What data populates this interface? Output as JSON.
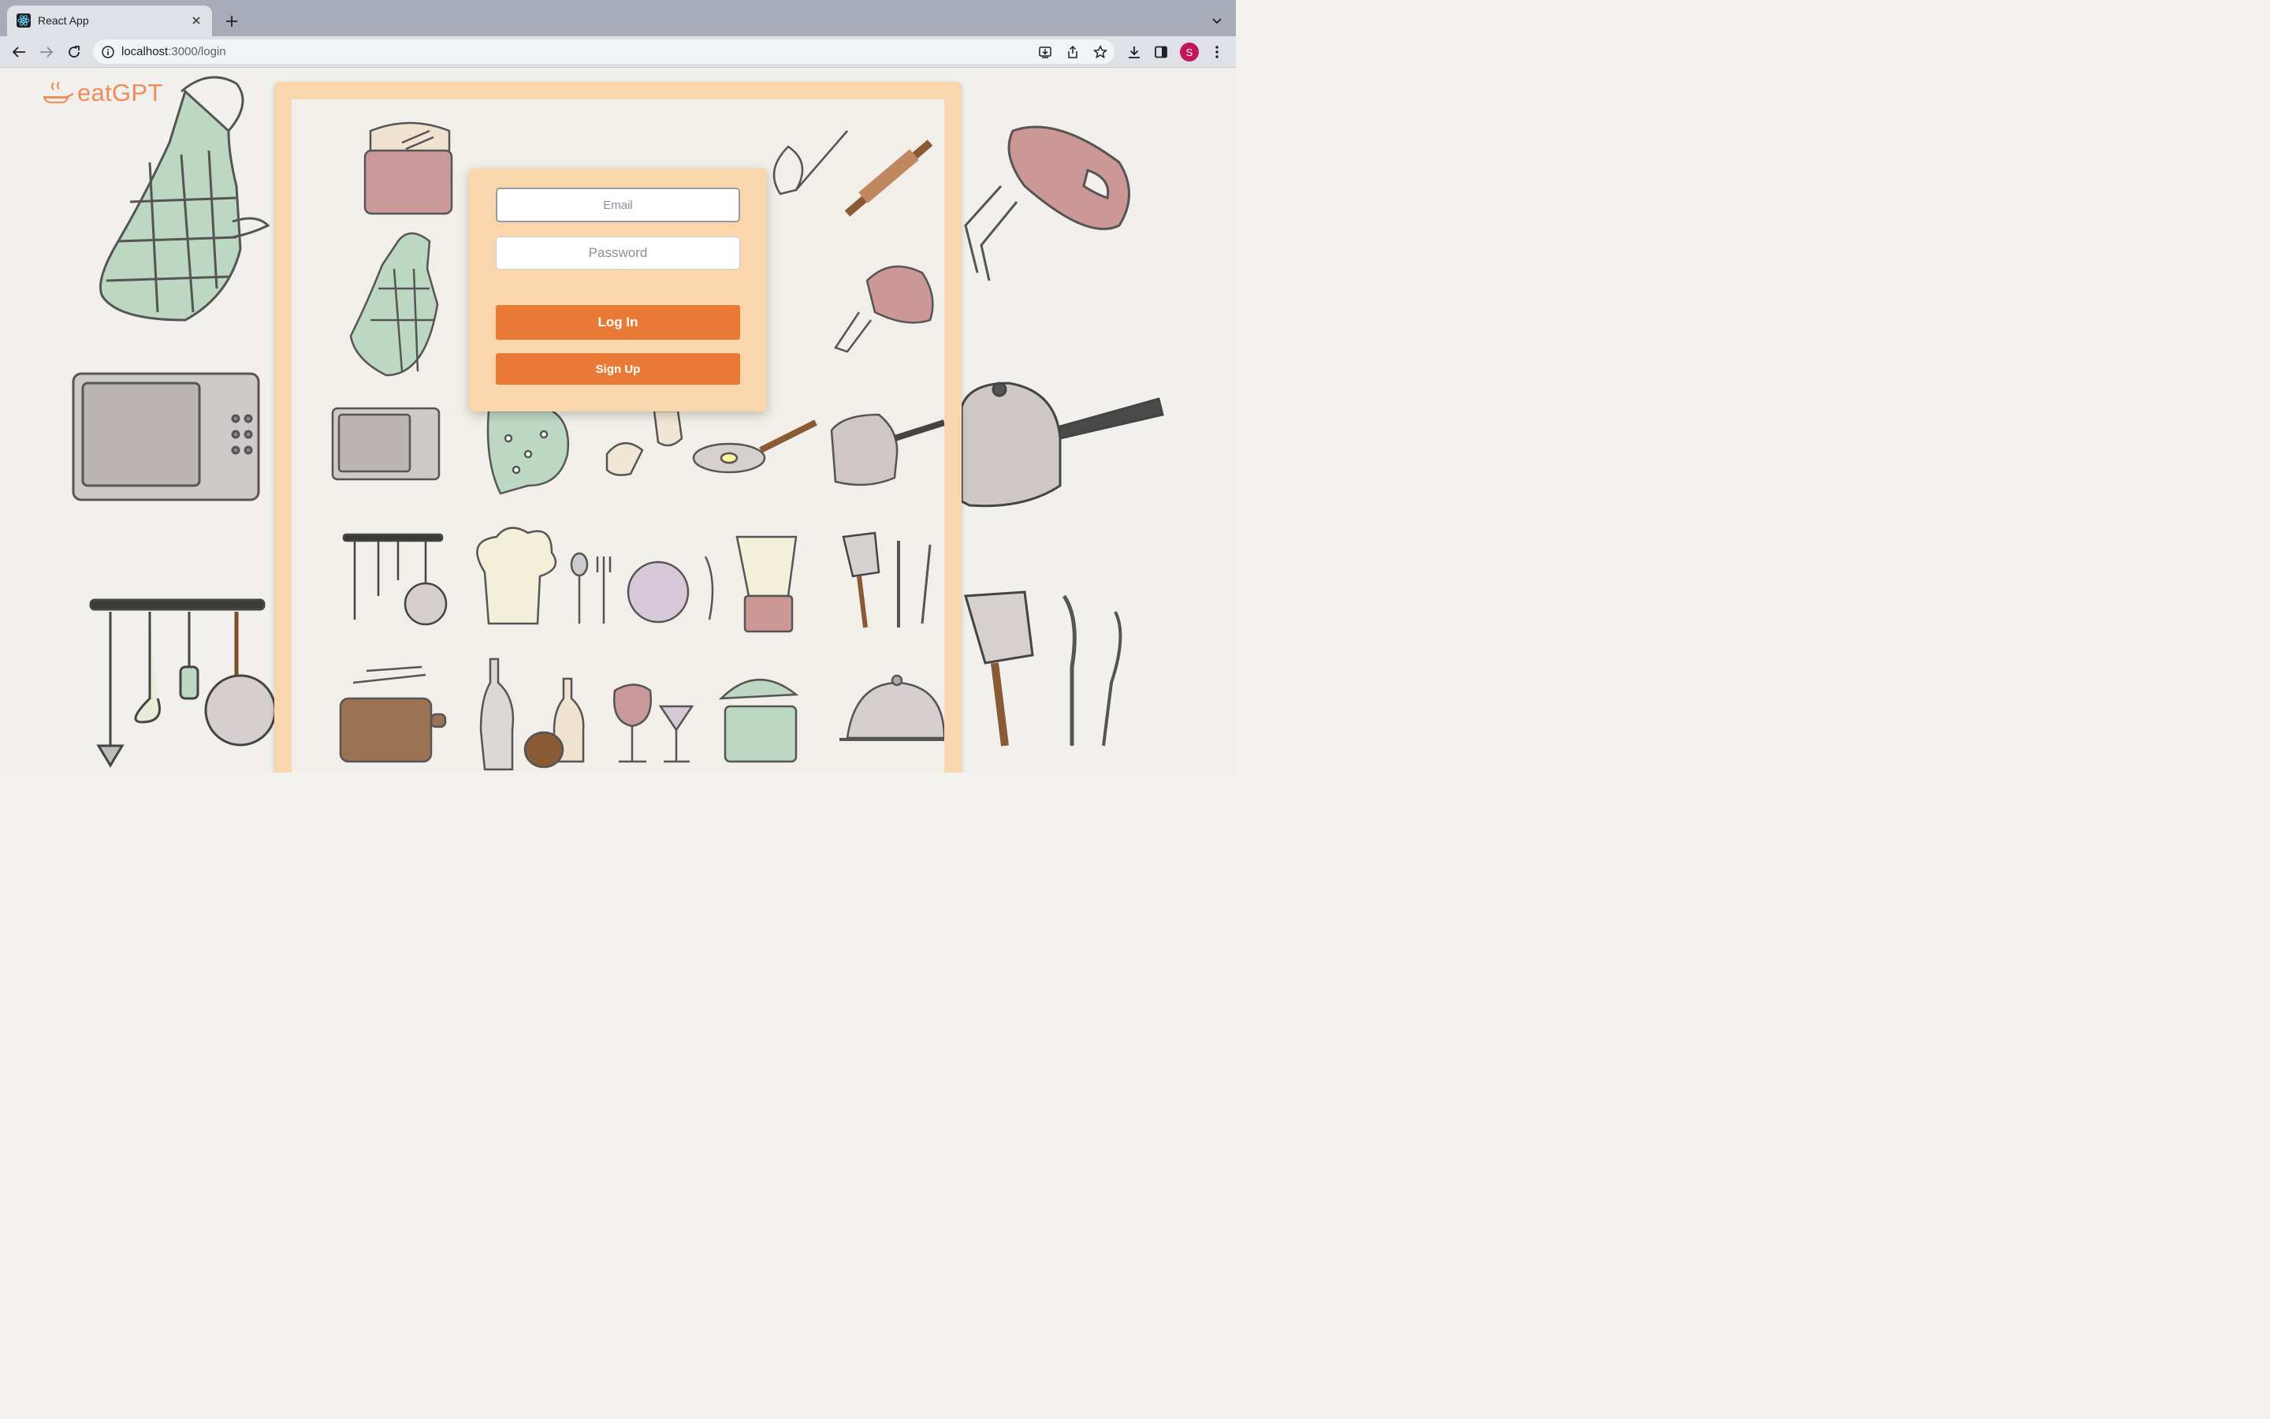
{
  "browser": {
    "tab_title": "React App",
    "url_host": "localhost",
    "url_path": ":3000/login",
    "profile_initial": "S",
    "icons": [
      "react-favicon",
      "close-icon",
      "plus-icon",
      "chevron-down-icon",
      "back-icon",
      "forward-icon",
      "reload-icon",
      "info-icon",
      "install-icon",
      "share-icon",
      "star-icon",
      "download-icon",
      "sidebar-icon",
      "kebab-menu-icon"
    ]
  },
  "app": {
    "logo_text": "eatGPT",
    "logo_icon": "frying-pan-icon"
  },
  "login": {
    "email_placeholder": "Email",
    "password_placeholder": "Password",
    "login_label": "Log In",
    "signup_label": "Sign Up"
  },
  "colors": {
    "accent": "#e87a35",
    "card": "#f9d6ab",
    "logo": "#f08c58"
  }
}
